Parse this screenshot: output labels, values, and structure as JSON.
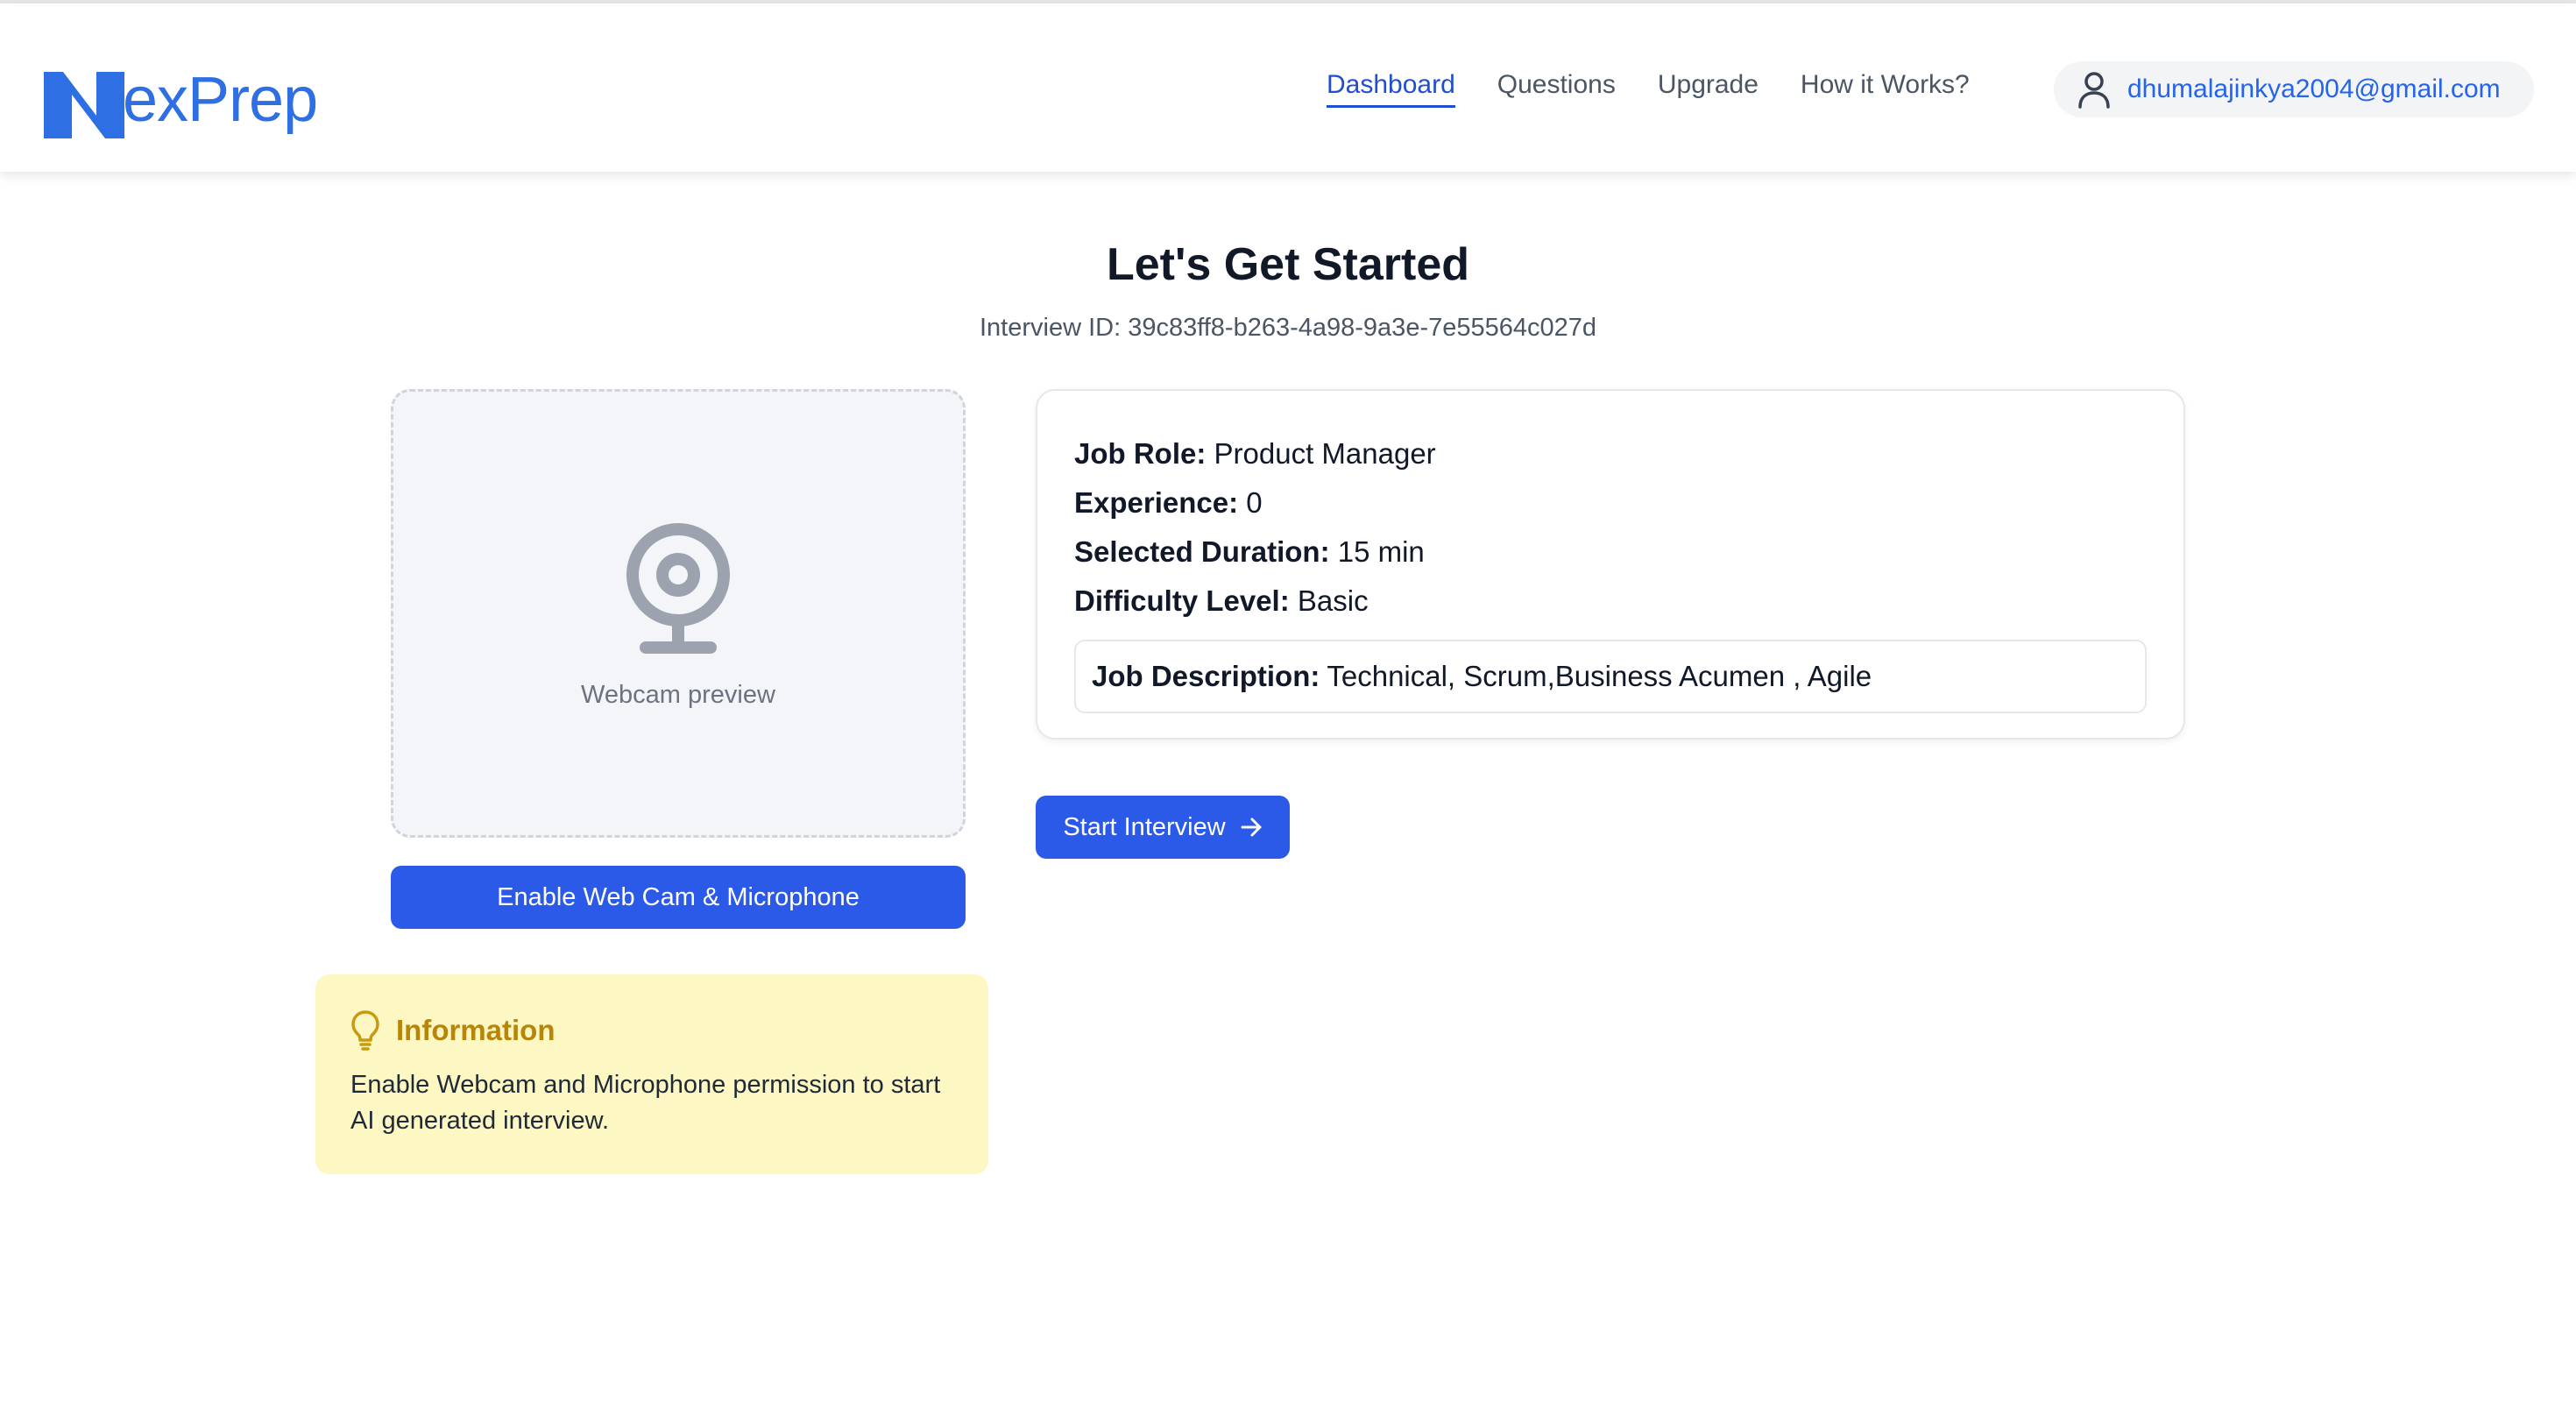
{
  "header": {
    "logo_text": "exPrep",
    "logo_letter": "N",
    "nav": [
      {
        "label": "Dashboard",
        "active": true
      },
      {
        "label": "Questions",
        "active": false
      },
      {
        "label": "Upgrade",
        "active": false
      },
      {
        "label": "How it Works?",
        "active": false
      }
    ],
    "user": {
      "icon": "user-icon",
      "email": "dhumalajinkya2004@gmail.com"
    }
  },
  "main": {
    "title": "Let's Get Started",
    "interview_id_label": "Interview ID: 39c83ff8-b263-4a98-9a3e-7e55564c027d"
  },
  "webcam": {
    "icon": "webcam-icon",
    "preview_label": "Webcam preview",
    "enable_button": "Enable Web Cam & Microphone"
  },
  "info": {
    "icon": "lightbulb-icon",
    "title": "Information",
    "text": "Enable Webcam and Microphone permission to start AI generated interview."
  },
  "details": {
    "job_role_key": "Job Role:",
    "job_role": "Product Manager",
    "experience_key": "Experience:",
    "experience": "0",
    "duration_key": "Selected Duration:",
    "duration": "15 min",
    "difficulty_key": "Difficulty Level:",
    "difficulty": "Basic",
    "job_description_key": "Job Description:",
    "job_description": "Technical, Scrum,Business Acumen , Agile"
  },
  "start_button": {
    "label": "Start Interview",
    "icon": "arrow-right-icon"
  },
  "colors": {
    "accent": "#2b59e8",
    "brand": "#2f6fe4",
    "info_bg": "#fdf7c3",
    "info_title": "#b7850a"
  }
}
